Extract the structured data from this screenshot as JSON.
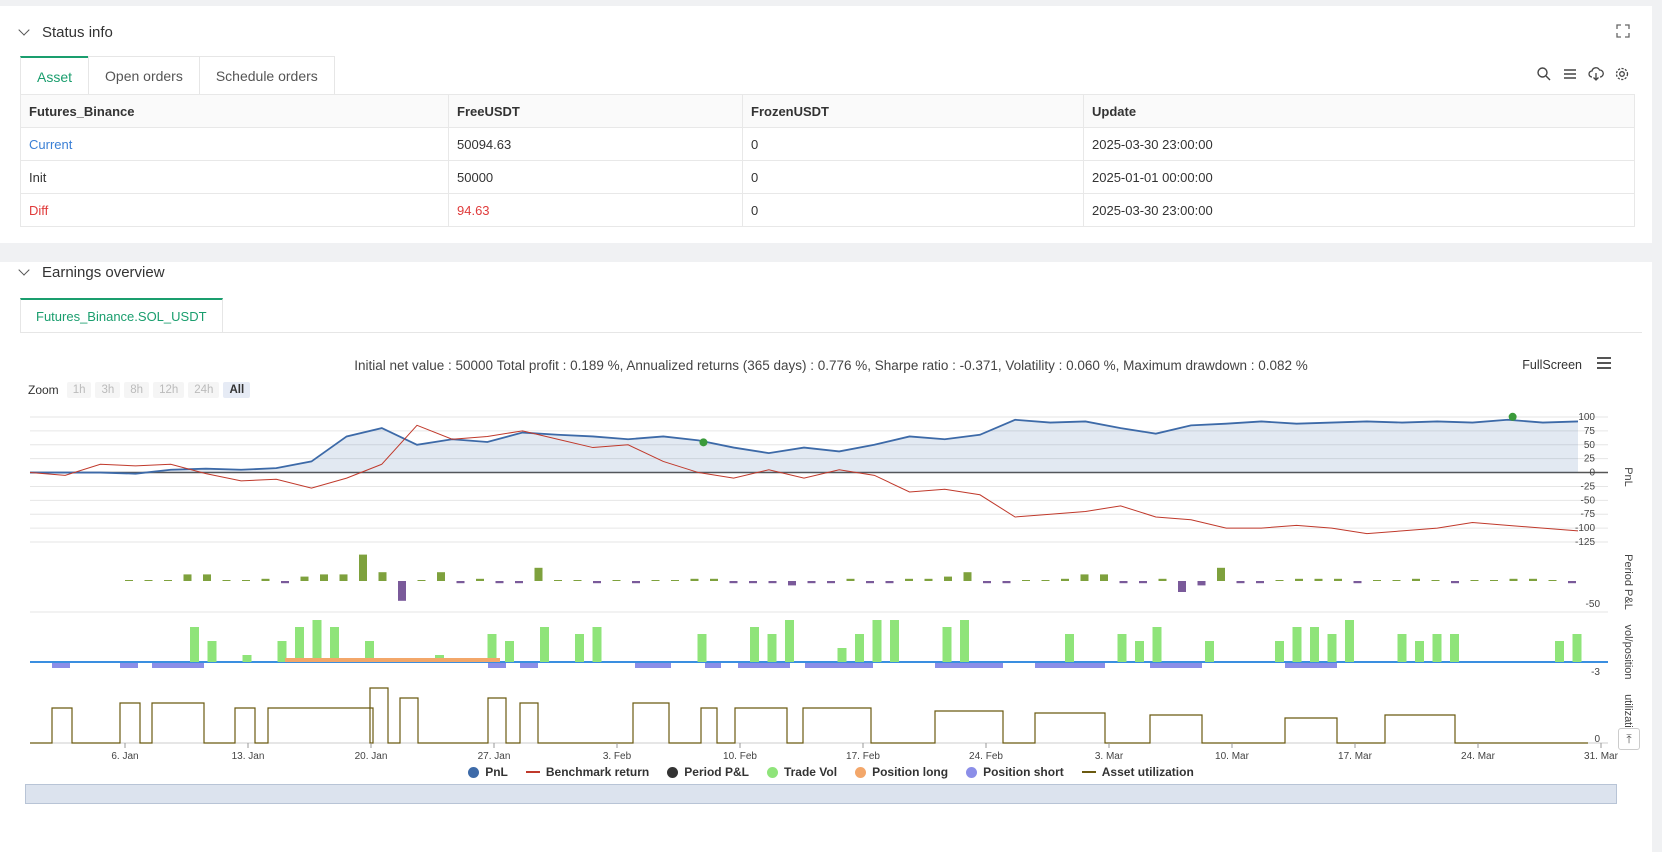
{
  "status": {
    "title": "Status info",
    "tabs": [
      "Asset",
      "Open orders",
      "Schedule orders"
    ],
    "table": {
      "headers": [
        "Futures_Binance",
        "FreeUSDT",
        "FrozenUSDT",
        "Update"
      ],
      "rows": [
        {
          "label": "Current",
          "free": "50094.63",
          "frozen": "0",
          "update": "2025-03-30 23:00:00"
        },
        {
          "label": "Init",
          "free": "50000",
          "frozen": "0",
          "update": "2025-01-01 00:00:00"
        },
        {
          "label": "Diff",
          "free": "94.63",
          "frozen": "0",
          "update": "2025-03-30 23:00:00"
        }
      ]
    }
  },
  "earnings": {
    "title": "Earnings overview",
    "symbol_tab": "Futures_Binance.SOL_USDT",
    "summary": "Initial net value : 50000 Total profit : 0.189 %, Annualized returns (365 days) : 0.776 %, Sharpe ratio : -0.371, Volatility : 0.060 %, Maximum drawdown : 0.082 %",
    "fullscreen_label": "FullScreen",
    "zoom_label": "Zoom",
    "zoom_options": [
      "1h",
      "3h",
      "8h",
      "12h",
      "24h",
      "All"
    ],
    "legend": [
      "PnL",
      "Benchmark return",
      "Period P&L",
      "Trade Vol",
      "Position long",
      "Position short",
      "Asset utilization"
    ]
  },
  "chart_data": {
    "type": "line",
    "x_ticks": [
      "6. Jan",
      "13. Jan",
      "20. Jan",
      "27. Jan",
      "3. Feb",
      "10. Feb",
      "17. Feb",
      "24. Feb",
      "3. Mar",
      "10. Mar",
      "17. Mar",
      "24. Mar",
      "31. Mar"
    ],
    "panes": [
      {
        "name": "PnL",
        "y_ticks": [
          100,
          75,
          50,
          25,
          0,
          -25,
          -50,
          -75,
          -100,
          -125
        ]
      },
      {
        "name": "Period P&L",
        "y_ticks": [
          -50
        ]
      },
      {
        "name": "vol/position",
        "y_ticks": [
          -3
        ]
      },
      {
        "name": "utilization",
        "y_ticks": [
          0
        ]
      }
    ],
    "series": [
      {
        "name": "PnL",
        "color": "#3d6aa8",
        "values": [
          0,
          0,
          0,
          -2,
          5,
          7,
          5,
          8,
          20,
          65,
          80,
          50,
          60,
          55,
          72,
          68,
          65,
          60,
          65,
          58,
          45,
          35,
          45,
          38,
          50,
          65,
          60,
          68,
          95,
          90,
          92,
          80,
          70,
          85,
          88,
          92,
          88,
          90,
          92,
          90,
          92,
          90,
          95,
          90,
          92
        ]
      },
      {
        "name": "Benchmark return",
        "color": "#c0392b",
        "values": [
          0,
          -5,
          15,
          12,
          15,
          -2,
          -15,
          -12,
          -28,
          -10,
          15,
          85,
          60,
          65,
          75,
          60,
          45,
          50,
          20,
          0,
          -10,
          5,
          -10,
          5,
          -5,
          -35,
          -30,
          -40,
          -80,
          -75,
          -70,
          -60,
          -80,
          -85,
          -100,
          -100,
          -95,
          -100,
          -110,
          -105,
          -100,
          -90,
          -95,
          -100,
          -105
        ]
      }
    ]
  }
}
